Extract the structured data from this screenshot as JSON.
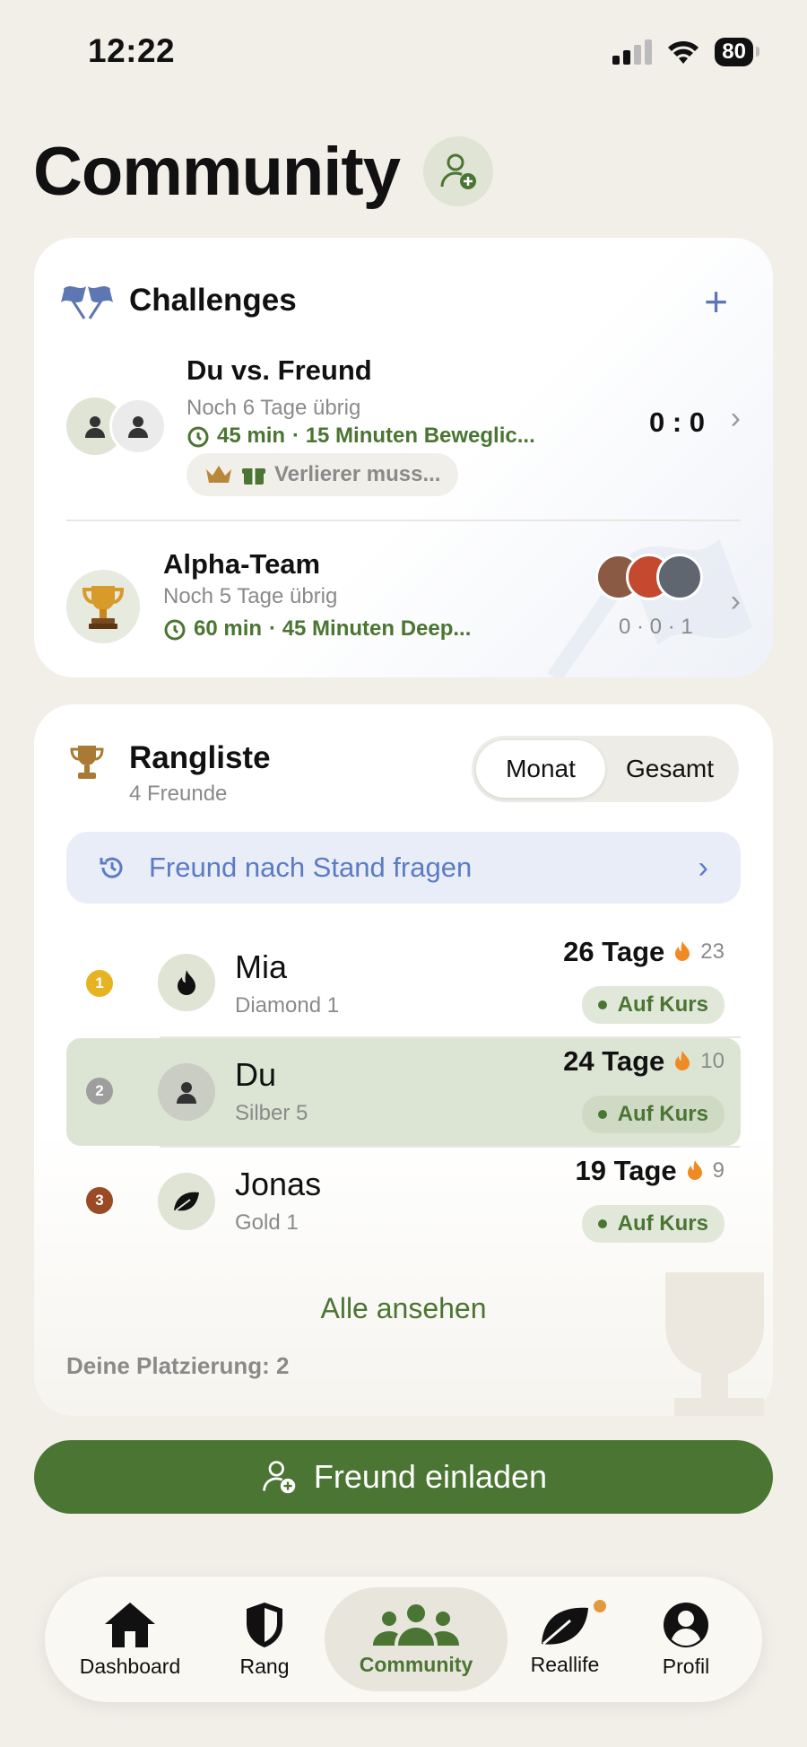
{
  "status": {
    "time": "12:22",
    "battery": "80"
  },
  "header": {
    "title": "Community"
  },
  "challenges": {
    "title": "Challenges",
    "items": [
      {
        "name": "Du vs. Freund",
        "remaining": "Noch 6 Tage übrig",
        "duration": "45 min",
        "detail": "· 15 Minuten Beweglic...",
        "stake": "Verlierer muss...",
        "score": "0 : 0"
      },
      {
        "name": "Alpha-Team",
        "remaining": "Noch 5 Tage übrig",
        "duration": "60 min",
        "detail": "· 45 Minuten Deep...",
        "score": "0 · 0 · 1"
      }
    ]
  },
  "ranking": {
    "title": "Rangliste",
    "subtitle": "4 Freunde",
    "tabs": [
      "Monat",
      "Gesamt"
    ],
    "ask_label": "Freund nach Stand fragen",
    "rows": [
      {
        "rank": "1",
        "name": "Mia",
        "level": "Diamond 1",
        "days": "26 Tage",
        "streak": "23",
        "status": "Auf Kurs"
      },
      {
        "rank": "2",
        "name": "Du",
        "level": "Silber 5",
        "days": "24 Tage",
        "streak": "10",
        "status": "Auf Kurs"
      },
      {
        "rank": "3",
        "name": "Jonas",
        "level": "Gold 1",
        "days": "19 Tage",
        "streak": "9",
        "status": "Auf Kurs"
      }
    ],
    "see_all": "Alle ansehen",
    "placement": "Deine Platzierung: 2"
  },
  "invite_label": "Freund einladen",
  "tabs": [
    "Dashboard",
    "Rang",
    "Community",
    "Reallife",
    "Profil"
  ],
  "colors": {
    "accent": "#4b7532",
    "blue": "#5b7bc4",
    "background": "#f2efe9"
  }
}
